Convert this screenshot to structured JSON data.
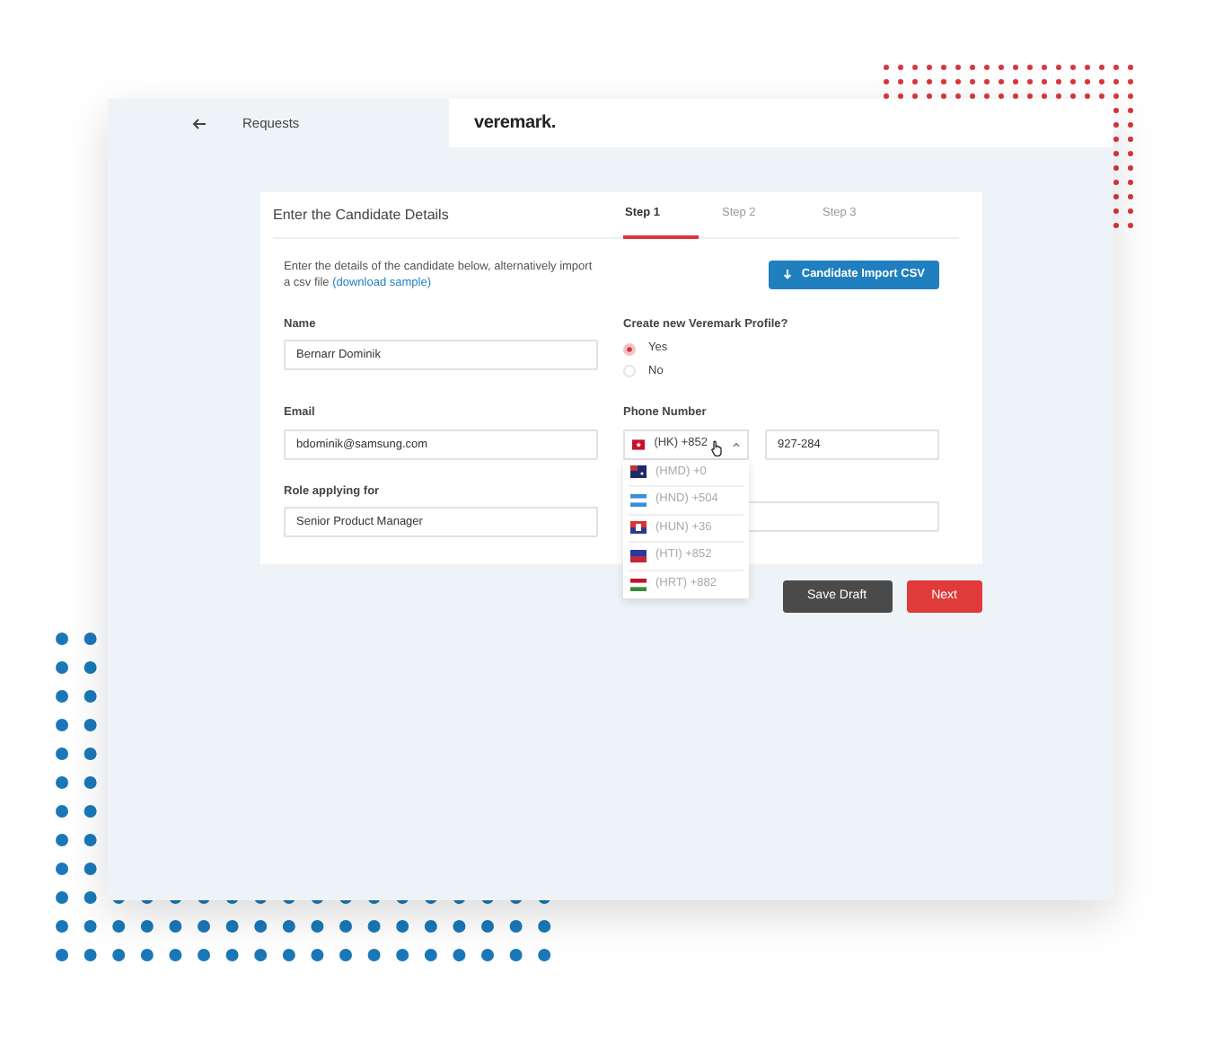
{
  "header": {
    "breadcrumb": "Requests",
    "logo": "veremark."
  },
  "form": {
    "title": "Enter the Candidate Details",
    "steps": [
      {
        "label": "Step 1",
        "selected": true
      },
      {
        "label": "Step 2",
        "selected": false
      },
      {
        "label": "Step 3",
        "selected": false
      }
    ],
    "intro": "Enter the details of the candidate below, alternatively import a csv file",
    "intro_link": "(download sample)",
    "import_button": "Candidate Import CSV",
    "fields": [
      {
        "label": "Name",
        "value": "Bernarr Dominik"
      },
      {
        "label": "Email",
        "value": "bdominik@samsung.com"
      },
      {
        "label": "Role applying for",
        "value": "Senior Product Manager"
      }
    ],
    "profile": {
      "label": "Create new Veremark Profile?",
      "options": [
        {
          "label": "Yes",
          "selected": true
        },
        {
          "label": "No",
          "selected": false
        }
      ]
    },
    "phone": {
      "label": "Phone Number",
      "country": "(HK) +852",
      "expanded": true,
      "number": "927-284",
      "options": [
        "(HMD) +0",
        "(HND) +504",
        "(HUN) +36",
        "(HTI) +852",
        "(HRT) +882"
      ]
    },
    "buttons": [
      {
        "label": "Save Draft",
        "kind": "secondary"
      },
      {
        "label": "Next",
        "kind": "primary"
      }
    ]
  }
}
